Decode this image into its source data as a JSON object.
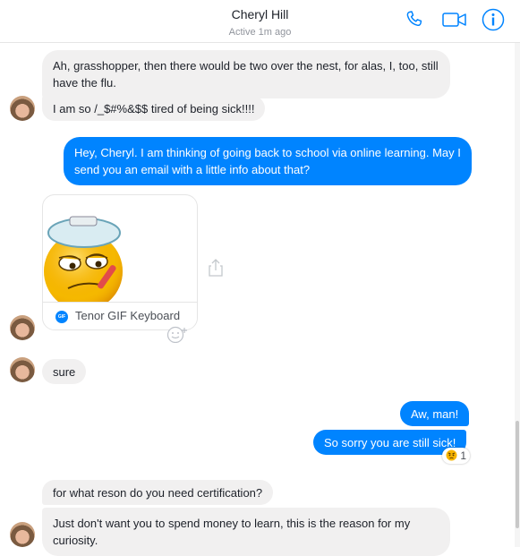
{
  "header": {
    "contact_name": "Cheryl Hill",
    "status": "Active 1m ago"
  },
  "icons": {
    "call": "phone-icon",
    "video": "video-camera-icon",
    "info": "info-icon",
    "share": "share-icon",
    "react": "add-reaction-icon",
    "reaction_emoji": "angry-face-emoji"
  },
  "colors": {
    "accent": "#0084ff",
    "incoming_bg": "#f1f0f0"
  },
  "messages": [
    {
      "from": "Cheryl Hill",
      "text": "Ah, grasshopper, then there would be two over the nest, for alas, I, too, still have the flu."
    },
    {
      "from": "Cheryl Hill",
      "text": "I am so /_$#%&$$ tired of being sick!!!!"
    },
    {
      "from": "me",
      "text": "Hey, Cheryl.  I am thinking of going back to school via online learning.  May I send you an email with a little info about that?"
    },
    {
      "from": "Cheryl Hill",
      "gif_source": "Tenor GIF Keyboard",
      "gif_badge": "GIF"
    },
    {
      "from": "Cheryl Hill",
      "text": "sure"
    },
    {
      "from": "me",
      "text": "Aw, man!"
    },
    {
      "from": "me",
      "text": "So sorry you are still sick!",
      "reaction_count": "1"
    },
    {
      "from": "Cheryl Hill",
      "text": "for what reson do you need certification?"
    },
    {
      "from": "Cheryl Hill",
      "text": "Just don't want you to spend money to learn, this is the reason for my curiosity."
    }
  ]
}
